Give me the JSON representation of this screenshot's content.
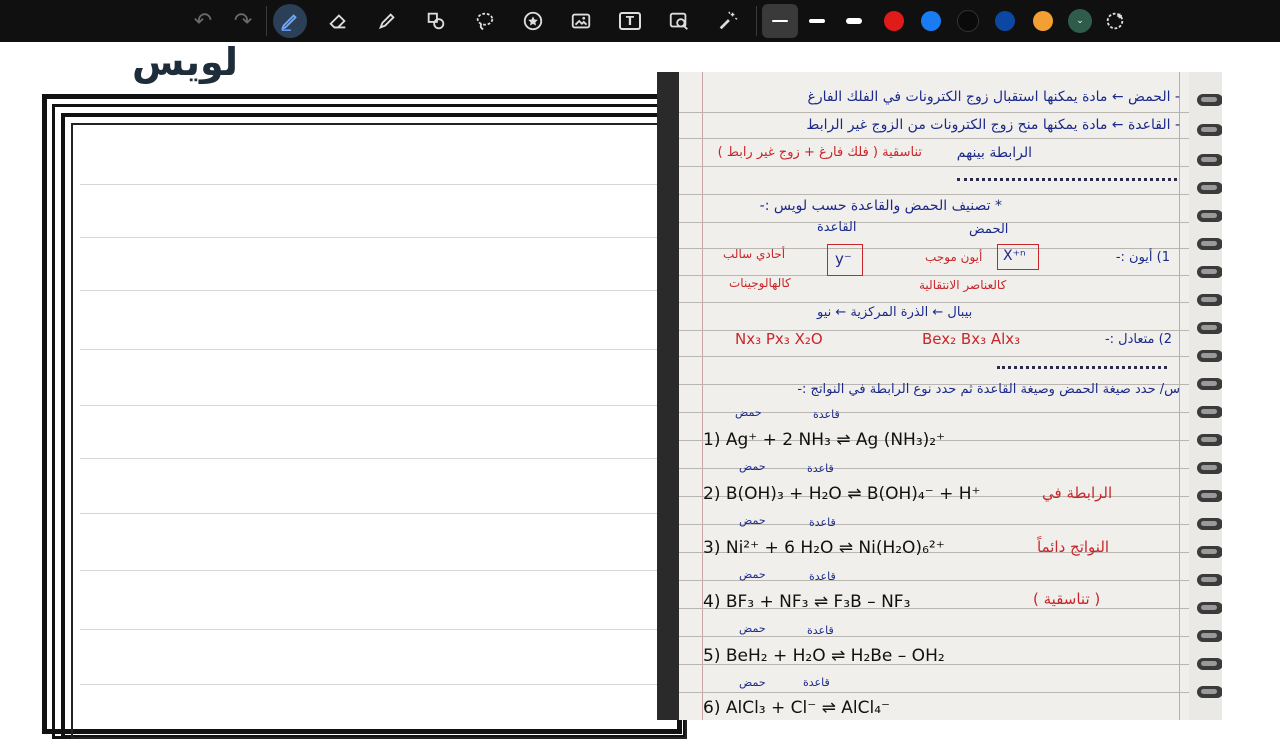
{
  "toolbar": {
    "tools": [
      {
        "name": "undo-icon",
        "glyph": "↶"
      },
      {
        "name": "redo-icon",
        "glyph": "↷"
      },
      {
        "name": "pen-icon"
      },
      {
        "name": "eraser-icon"
      },
      {
        "name": "highlighter-icon"
      },
      {
        "name": "shapes-icon"
      },
      {
        "name": "lasso-icon"
      },
      {
        "name": "sticker-icon"
      },
      {
        "name": "image-icon"
      },
      {
        "name": "text-icon",
        "glyph": "T"
      },
      {
        "name": "image-search-icon"
      },
      {
        "name": "laser-pointer-icon"
      }
    ],
    "colors": [
      "#e11a1a",
      "#1a7cf2",
      "#0a0a0a",
      "#0b47a3",
      "#f2a033",
      "#2f5c4b"
    ]
  },
  "canvas": {
    "title": "لويس"
  },
  "notes": {
    "l1": "- الحمض ← مادة يمكنها استقبال زوج الكترونات في الفلك الفارغ",
    "l2": "- القاعدة ← مادة يمكنها منح زوج الكترونات من الزوج غير الرابط",
    "l3a": "الرابطة بينهم",
    "l3b": "تناسقية ( فلك فارغ + زوج غير رابط )",
    "l4": "* تصنيف الحمض والقاعدة حسب لويس :-",
    "col_base": "القاعدة",
    "col_acid": "الحمض",
    "ion_label": "1) أيون :-",
    "acid_ion": "X⁺ⁿ",
    "acid_desc1": "أيون موجب",
    "acid_desc2": "كالعناصر الانتقالية",
    "base_ion": "y⁻",
    "base_desc1": "أحادي سالب",
    "base_desc2": "كالهالوجينات",
    "central": "بيبال ← الذرة المركزية ← نيو",
    "neutral_label": "2) متعادل :-",
    "neutral_acid": "Bex₂   Bx₃   Alx₃",
    "neutral_base": "Nx₃   Px₃   X₂O",
    "q_label": "س/ حدد صيغة الحمض وصيغة القاعدة ثم حدد نوع الرابطة في النواتج :-",
    "tag_acid": "حمض",
    "tag_base": "قاعدة",
    "r1": "1)  Ag⁺  +  2 NH₃  ⇌  Ag (NH₃)₂⁺",
    "r2": "2)  B(OH)₃  +  H₂O  ⇌  B(OH)₄⁻  +  H⁺",
    "r3": "3)  Ni²⁺  +  6 H₂O  ⇌  Ni(H₂O)₆²⁺",
    "r4": "4)  BF₃  +  NF₃  ⇌  F₃B – NF₃",
    "r5": "5)  BeH₂  +  H₂O  ⇌  H₂Be – OH₂",
    "r6": "6)  AlCl₃  +  Cl⁻  ⇌  AlCl₄⁻",
    "side1": "الرابطة في",
    "side2": "النواتج دائماً",
    "side3": "( تناسقية )"
  }
}
